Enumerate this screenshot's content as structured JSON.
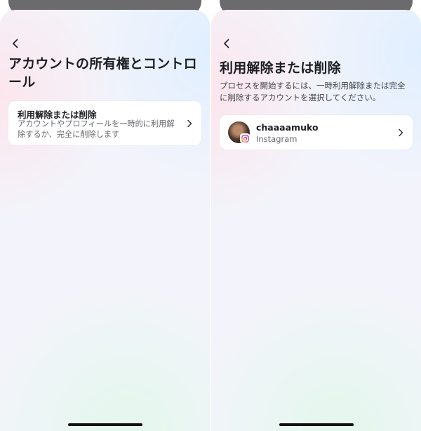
{
  "left_screen": {
    "title": "アカウントの所有権とコントロール",
    "option": {
      "title": "利用解除または削除",
      "description": "アカウントやプロフィールを一時的に利用解除するか、完全に削除します"
    }
  },
  "right_screen": {
    "title": "利用解除または削除",
    "subtitle": "プロセスを開始するには、一時利用解除または完全に削除するアカウントを選択してください。",
    "account": {
      "username": "chaaaamuko",
      "platform": "Instagram"
    }
  },
  "icons": {
    "back": "chevron-left-icon",
    "forward": "chevron-right-icon",
    "badge": "instagram-icon"
  },
  "colors": {
    "card_bg": "#ffffff",
    "text_primary": "#1c1e21",
    "text_secondary": "#65676b",
    "instagram_gradient": [
      "#f9a03f",
      "#e1306c",
      "#833ab4"
    ]
  }
}
